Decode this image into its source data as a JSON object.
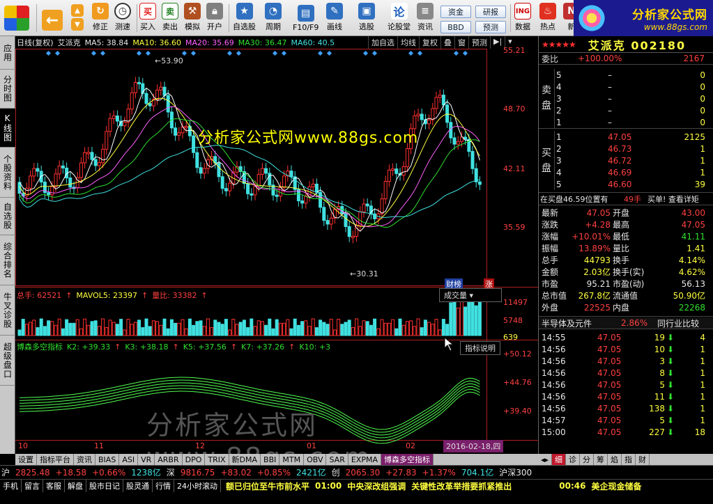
{
  "toolbar": {
    "buttons": [
      {
        "label": "修正"
      },
      {
        "label": "测速"
      },
      {
        "label": "买入"
      },
      {
        "label": "卖出"
      },
      {
        "label": "模拟"
      },
      {
        "label": "开户"
      },
      {
        "label": "自选股"
      },
      {
        "label": "周期"
      },
      {
        "label": "F10/F9"
      },
      {
        "label": "画线"
      },
      {
        "label": "选股"
      },
      {
        "label": "论股堂"
      },
      {
        "label": "资讯"
      },
      {
        "label": "数据"
      },
      {
        "label": "热点"
      },
      {
        "label": "新"
      }
    ],
    "small": {
      "funds": "资金",
      "bbd": "BBD",
      "report": "研报",
      "forecast": "预测"
    },
    "logo_title": "分析家公式网",
    "logo_url": "www.88gs.com"
  },
  "sidetabs": [
    "应用",
    "分时图",
    "K线图",
    "个股资料",
    "自选股",
    "综合排名",
    "牛叉诊股",
    "超级盘口"
  ],
  "chart": {
    "legend": {
      "period": "日线(复权)",
      "name": "艾派克",
      "ma5": "MA5: 38.84",
      "ma10": "MA10: 36.60",
      "ma20": "MA20: 35.69",
      "ma30": "MA30: 36.47",
      "ma60": "MA60: 40.5"
    },
    "controls": [
      "加自选",
      "均线",
      "复权",
      "叠",
      "窗",
      "预测"
    ],
    "price_labels": [
      "55.21",
      "48.70",
      "42.11",
      "35.59"
    ],
    "high_label": "53.90",
    "low_label": "30.31",
    "watermark": "分析家公式网www.88gs.com",
    "watermark2": "分析家公式网www.88gs.com",
    "flags": {
      "cai": "财榜",
      "zhang": "涨"
    },
    "volume_legend": {
      "total": "总手: 62521",
      "mavol": "MAVOL5: 23397",
      "ratio": "量比: 33382"
    },
    "volume_dropdown": "成交量",
    "volume_labels": [
      "11497",
      "5748",
      "639"
    ],
    "indicator_legend": {
      "name": "博森多空指标",
      "k2": "K2: +39.33",
      "k3": "K3: +38.18",
      "k5": "K5: +37.56",
      "k7": "K7: +37.26",
      "k10": "K10: +3"
    },
    "indicator_button": "指标说明",
    "indicator_labels": [
      "+50.12",
      "+44.76",
      "+39.40"
    ],
    "date_labels": [
      "10",
      "11",
      "12",
      "01",
      "02"
    ],
    "date_box": "2016-02-18,四"
  },
  "bottom_tabs": [
    "设置",
    "指标平台",
    "资讯",
    "BIAS",
    "ASI",
    "VR",
    "ARBR",
    "DPO",
    "TRIX",
    "新DMA",
    "BBI",
    "MTM",
    "OBV",
    "SAR",
    "EXPMA",
    "博森多空指标"
  ],
  "quote": {
    "stars": "★★★★★",
    "name": "艾派克",
    "code": "002180",
    "weibi_label": "委比",
    "weibi": "+100.00%",
    "weicha": "2167",
    "sell_label": "卖盘",
    "buy_label": "买盘",
    "sell": [
      {
        "lvl": "5",
        "price": "–",
        "vol": "0"
      },
      {
        "lvl": "4",
        "price": "–",
        "vol": "0"
      },
      {
        "lvl": "3",
        "price": "–",
        "vol": "0"
      },
      {
        "lvl": "2",
        "price": "–",
        "vol": "0"
      },
      {
        "lvl": "1",
        "price": "–",
        "vol": "0"
      }
    ],
    "buy": [
      {
        "lvl": "1",
        "price": "47.05",
        "vol": "2125"
      },
      {
        "lvl": "2",
        "price": "46.73",
        "vol": "1"
      },
      {
        "lvl": "3",
        "price": "46.72",
        "vol": "1"
      },
      {
        "lvl": "4",
        "price": "46.69",
        "vol": "1"
      },
      {
        "lvl": "5",
        "price": "46.60",
        "vol": "39"
      }
    ],
    "inbuy": "在买盘46.59位置有",
    "inbuy_hand": "49手",
    "inbuy_action": "买单! 查看详矩",
    "stats": [
      {
        "k1": "最新",
        "v1": "47.05",
        "k2": "开盘",
        "v2": "43.00"
      },
      {
        "k1": "涨跌",
        "v1": "+4.28",
        "k2": "最高",
        "v2": "47.05"
      },
      {
        "k1": "涨幅",
        "v1": "+10.01%",
        "k2": "最低",
        "v2": "41.11"
      },
      {
        "k1": "振幅",
        "v1": "13.89%",
        "k2": "量比",
        "v2": "1.41"
      },
      {
        "k1": "总手",
        "v1": "44793",
        "k2": "换手",
        "v2": "4.14%"
      },
      {
        "k1": "金额",
        "v1": "2.03亿",
        "k2": "换手(实)",
        "v2": "4.62%"
      },
      {
        "k1": "市盈",
        "v1": "95.21",
        "k2": "市盈(动)",
        "v2": "56.13"
      },
      {
        "k1": "总市值",
        "v1": "267.8亿",
        "k2": "流通值",
        "v2": "50.90亿"
      },
      {
        "k1": "外盘",
        "v1": "22525",
        "k2": "内盘",
        "v2": "22268"
      }
    ],
    "sector": "半导体及元件",
    "sector_pct": "2.86%",
    "sector_cmp": "同行业比较",
    "ticks": [
      {
        "t": "14:55",
        "p": "47.05",
        "v": "19"
      },
      {
        "t": "14:56",
        "p": "47.05",
        "v": "10"
      },
      {
        "t": "14:56",
        "p": "47.05",
        "v": "3"
      },
      {
        "t": "14:56",
        "p": "47.05",
        "v": "8"
      },
      {
        "t": "14:56",
        "p": "47.05",
        "v": "5"
      },
      {
        "t": "14:56",
        "p": "47.05",
        "v": "11"
      },
      {
        "t": "14:56",
        "p": "47.05",
        "v": "138"
      },
      {
        "t": "14:57",
        "p": "47.05",
        "v": "5"
      },
      {
        "t": "15:00",
        "p": "47.05",
        "v": "227"
      }
    ],
    "tick_extra": [
      "4",
      "1",
      "1",
      "1",
      "1",
      "1",
      "1",
      "1",
      "18"
    ],
    "tabs": [
      "细",
      "诊",
      "分",
      "筹",
      "焰",
      "指",
      "财"
    ]
  },
  "status": {
    "sh": "沪",
    "sh_val": "2825.48",
    "sh_chg": "+18.58",
    "sh_pct": "+0.66%",
    "sh_amt": "1238亿",
    "sz": "深",
    "sz_val": "9816.75",
    "sz_chg": "+83.02",
    "sz_pct": "+0.85%",
    "sz_amt": "2421亿",
    "cy": "创",
    "cy_val": "2065.30",
    "cy_chg": "+27.83",
    "cy_pct": "+1.37%",
    "cy_amt": "704.1亿",
    "hs300": "沪深300"
  },
  "status2": {
    "buttons": [
      "手机",
      "留言",
      "客服",
      "解盘",
      "股市日记",
      "股灵通",
      "行情",
      "24小时滚动"
    ],
    "news1": "额已归位至牛市前水平",
    "news2_time": "01:00",
    "news2": "中央深改组强调",
    "news3": "关键性改革举措要抓紧推出",
    "news4_time": "00:46",
    "news4": "美企现金储备"
  }
}
